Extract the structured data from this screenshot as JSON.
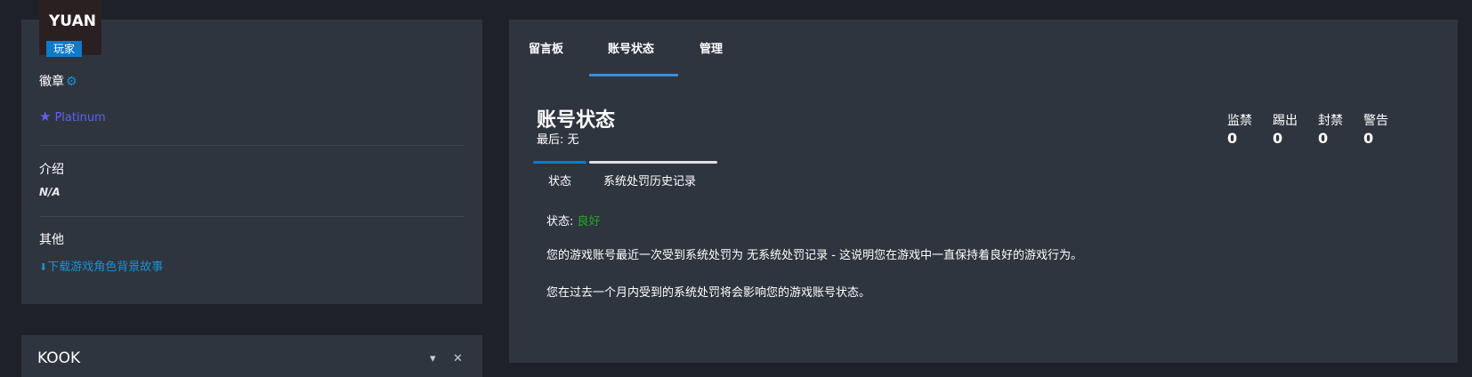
{
  "profile": {
    "name": "YUAN",
    "role": "玩家"
  },
  "left": {
    "badges_label": "徽章",
    "badge_name": "Platinum",
    "intro_label": "介绍",
    "intro_value": "N/A",
    "other_label": "其他",
    "download_link": "下载游戏角色背景故事"
  },
  "kook": {
    "title": "KOOK",
    "collapse": "▾",
    "close": "✕"
  },
  "top_tabs": [
    {
      "label": "留言板",
      "active": false
    },
    {
      "label": "账号状态",
      "active": true
    },
    {
      "label": "管理",
      "active": false
    }
  ],
  "account": {
    "title": "账号状态",
    "last": "最后: 无",
    "stats": [
      {
        "label": "监禁",
        "value": "0"
      },
      {
        "label": "踢出",
        "value": "0"
      },
      {
        "label": "封禁",
        "value": "0"
      },
      {
        "label": "警告",
        "value": "0"
      }
    ],
    "sub_tabs": [
      {
        "label": "状态"
      },
      {
        "label": "系统处罚历史记录"
      }
    ],
    "status_label": "状态:",
    "status_value": "良好",
    "para1": "您的游戏账号最近一次受到系统处罚为 无系统处罚记录 - 这说明您在游戏中一直保持着良好的游戏行为。",
    "para2": "您在过去一个月内受到的系统处罚将会影响您的游戏账号状态。"
  },
  "colors": {
    "accent": "#3a8de0",
    "link": "#1a8fd8",
    "badge": "#5e63f0",
    "good": "#22a822",
    "panel": "#2f353f",
    "background": "#1e2127"
  }
}
